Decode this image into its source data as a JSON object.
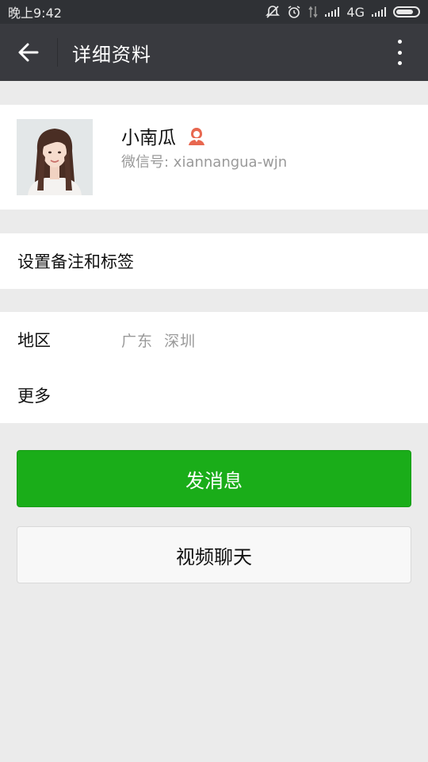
{
  "status_bar": {
    "time": "晚上9:42",
    "network": "4G"
  },
  "header": {
    "title": "详细资料",
    "back_icon": "arrow-left-icon",
    "more_icon": "more-vertical-icon"
  },
  "profile": {
    "name": "小南瓜",
    "gender_icon": "female-user-icon",
    "wechat_id_label": "微信号: xiannangua-wjn"
  },
  "cells": {
    "remark_tags": "设置备注和标签",
    "region_label": "地区",
    "region_value": "广东  深圳",
    "more": "更多"
  },
  "buttons": {
    "send_message": "发消息",
    "video_chat": "视频聊天"
  },
  "colors": {
    "accent_green": "#1aad19",
    "header_bg": "#393a3f",
    "status_bg": "#2f3135",
    "page_bg": "#ebebeb",
    "gender_icon": "#e8674f"
  }
}
